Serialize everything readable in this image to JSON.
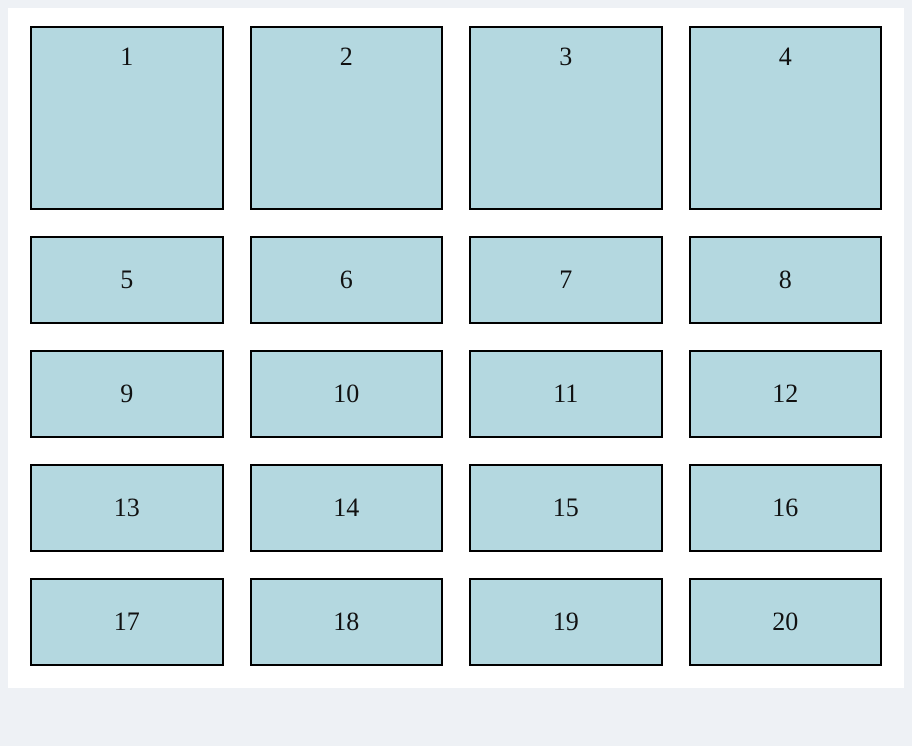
{
  "grid": {
    "rows": [
      {
        "cells": [
          "1",
          "2",
          "3",
          "4"
        ],
        "tall": true
      },
      {
        "cells": [
          "5",
          "6",
          "7",
          "8"
        ],
        "tall": false
      },
      {
        "cells": [
          "9",
          "10",
          "11",
          "12"
        ],
        "tall": false
      },
      {
        "cells": [
          "13",
          "14",
          "15",
          "16"
        ],
        "tall": false
      },
      {
        "cells": [
          "17",
          "18",
          "19",
          "20"
        ],
        "tall": false
      }
    ]
  },
  "colors": {
    "cell_bg": "#b4d8e0",
    "cell_border": "#000000",
    "page_bg": "#eef1f5",
    "panel_bg": "#ffffff"
  }
}
